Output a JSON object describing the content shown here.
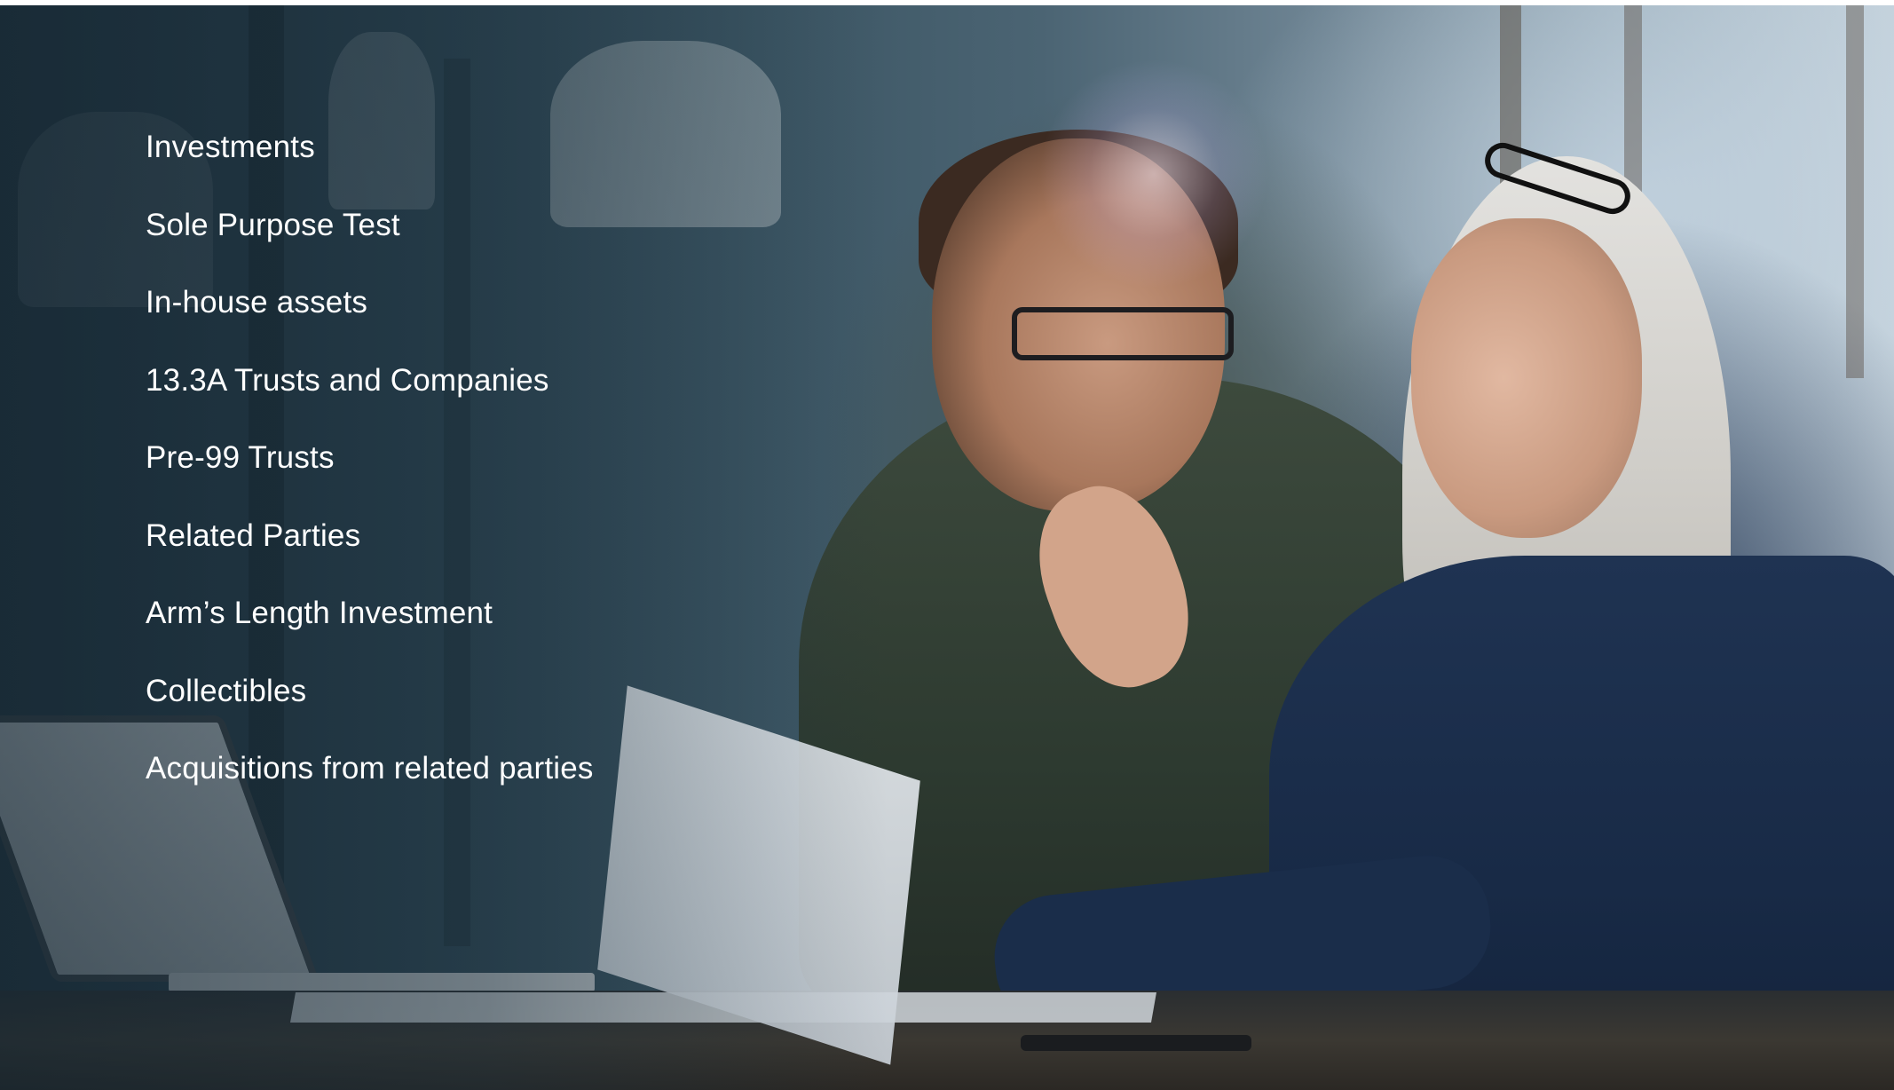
{
  "topics": [
    "Investments",
    "Sole Purpose Test",
    "In-house assets",
    "13.3A Trusts and Companies",
    "Pre-99 Trusts",
    "Related Parties",
    "Arm’s Length Investment",
    "Collectibles",
    "Acquisitions from related parties"
  ],
  "colors": {
    "text": "#ffffff",
    "overlay": "#1f3542"
  }
}
